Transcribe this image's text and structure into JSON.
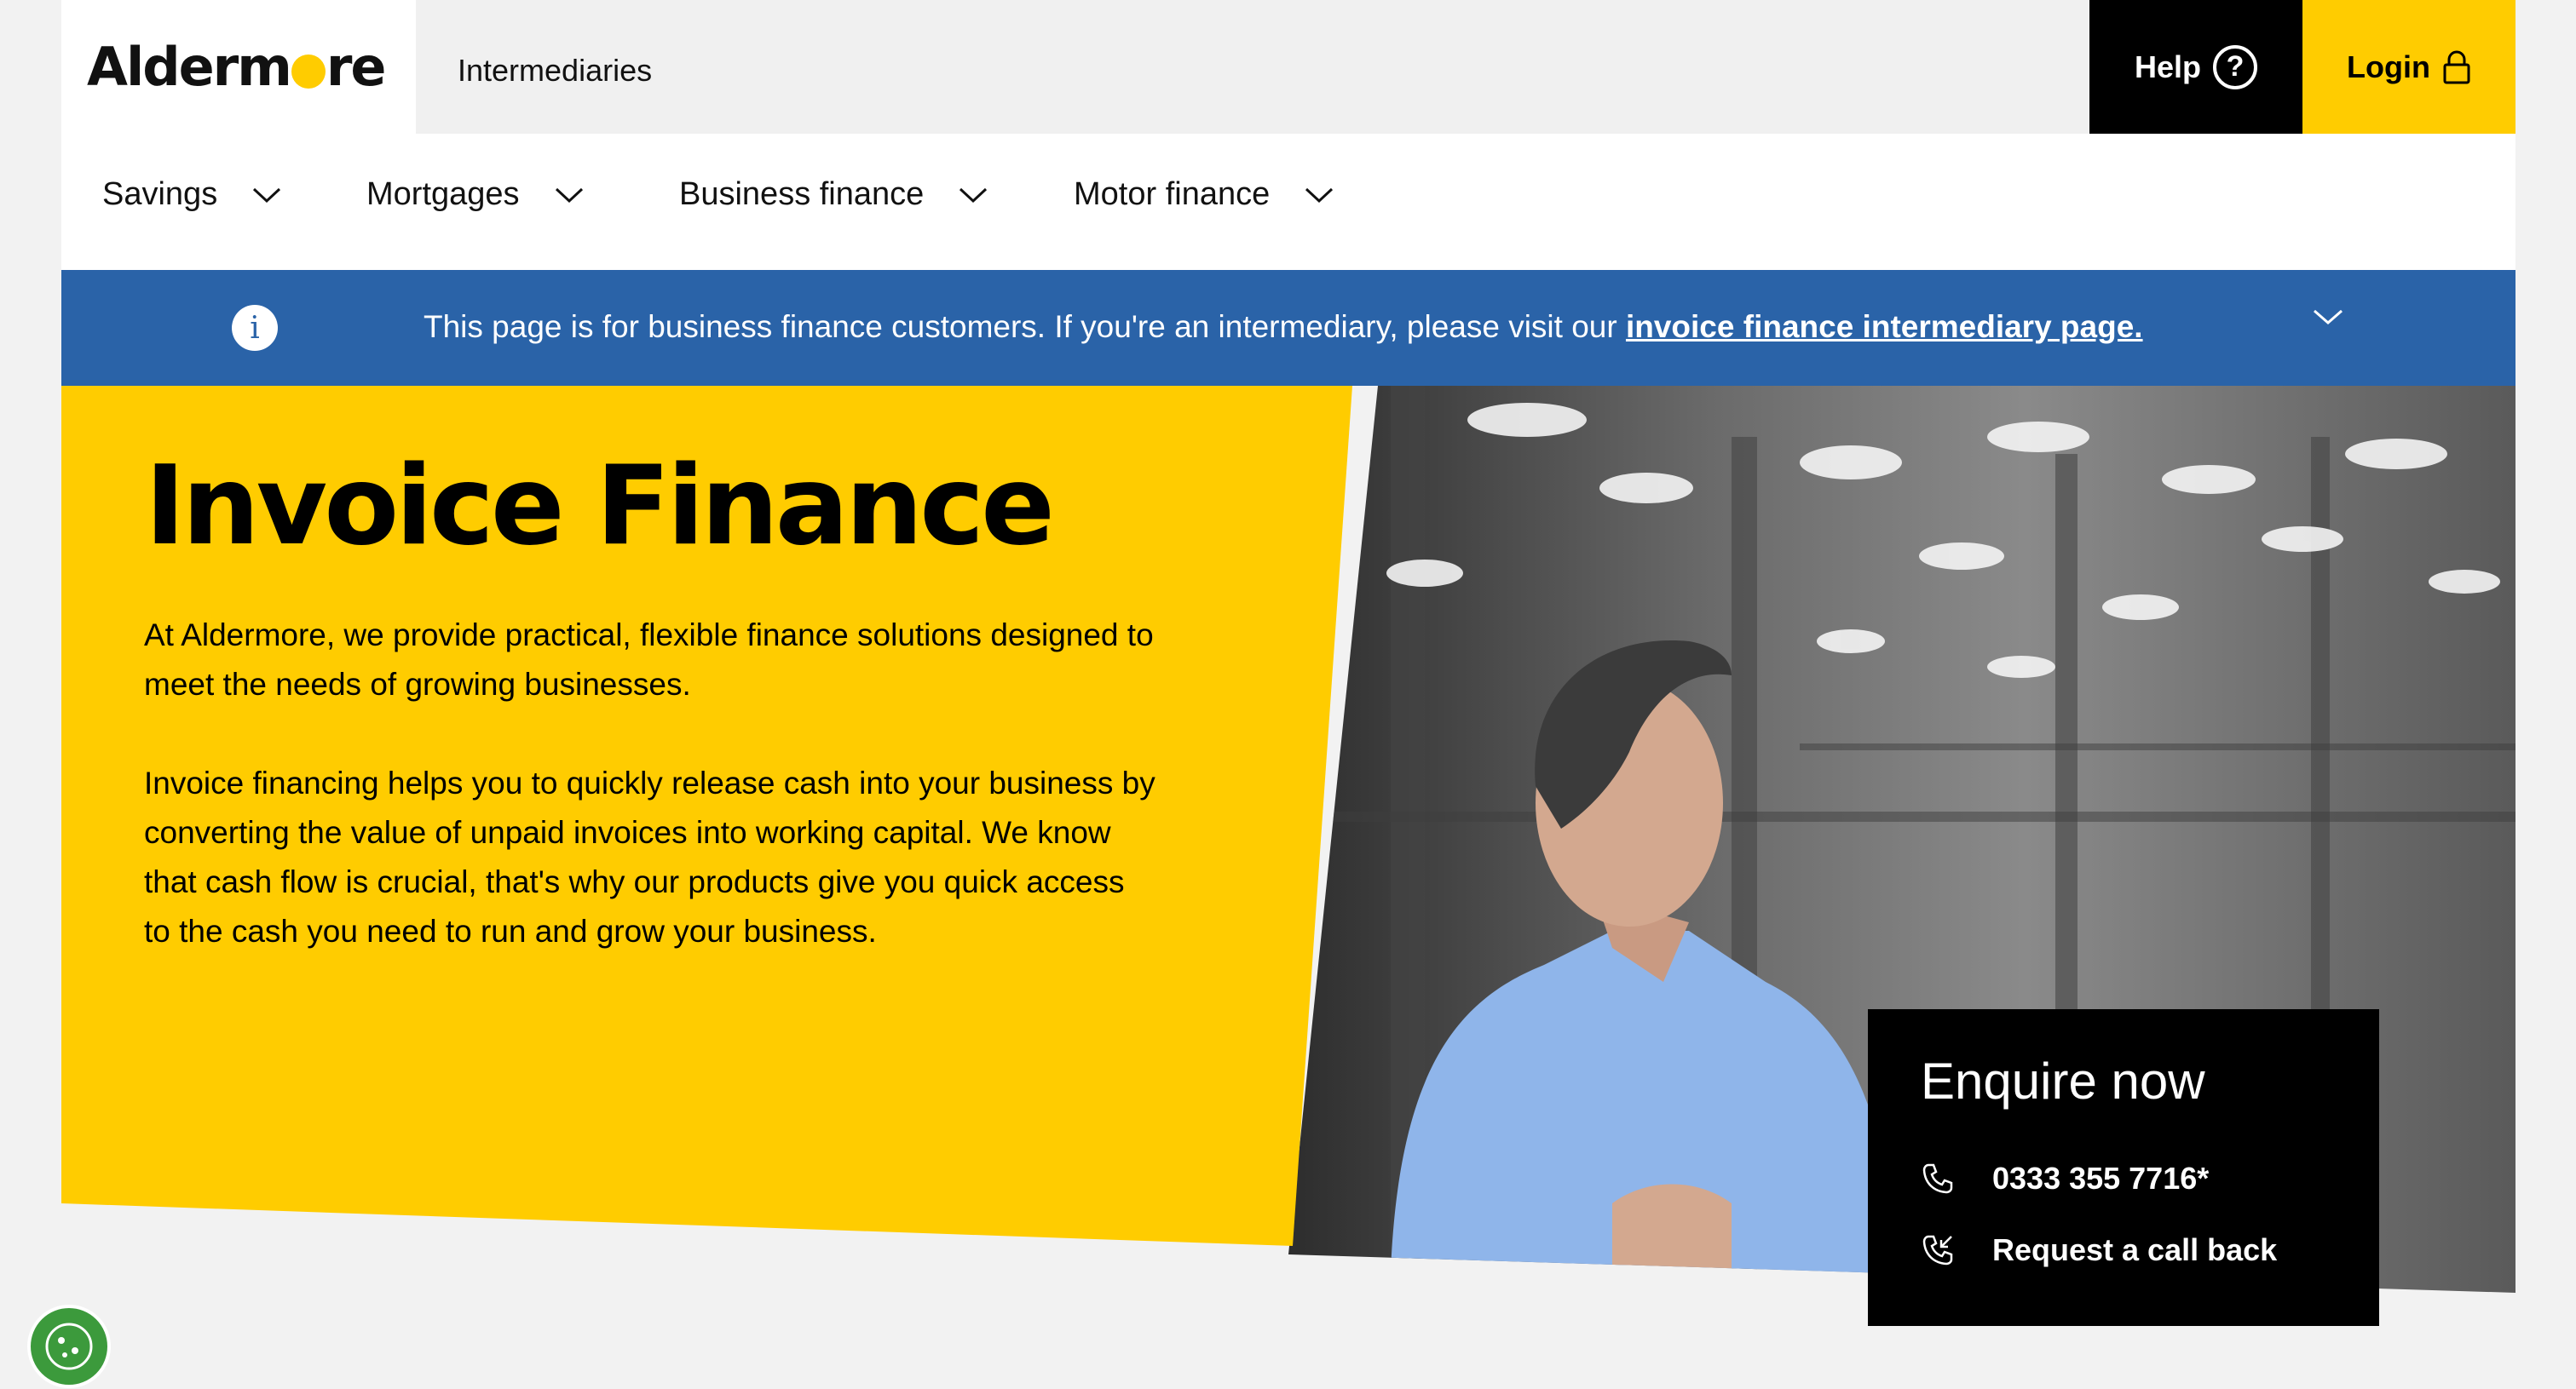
{
  "brand": {
    "logo_text_start": "Alderm",
    "logo_text_end": "re",
    "color_yellow": "#ffcc00",
    "color_blue": "#2a63a8"
  },
  "header": {
    "intermediaries": "Intermediaries",
    "help_label": "Help",
    "help_icon_glyph": "?",
    "login_label": "Login"
  },
  "nav": {
    "items": [
      {
        "label": "Savings"
      },
      {
        "label": "Mortgages"
      },
      {
        "label": "Business finance"
      },
      {
        "label": "Motor finance"
      }
    ]
  },
  "notice": {
    "info_glyph": "i",
    "text": "This page is for business finance customers. If you're an intermediary, please visit our ",
    "link": "invoice finance intermediary page."
  },
  "hero": {
    "title": "Invoice Finance",
    "p1_line1": "At Aldermore, we provide practical, flexible finance solutions designed to",
    "p1_line2": "meet the needs of growing businesses.",
    "p2_line1": "Invoice financing helps you to quickly release cash into your business by",
    "p2_line2": "converting the value of unpaid invoices into working capital. We know",
    "p2_line3": "that cash flow is crucial, that's why our products give you quick access",
    "p2_line4": "to the cash you need to run and grow your business."
  },
  "enquire": {
    "title": "Enquire now",
    "phone": "0333 355 7716*",
    "callback": "Request a call back"
  }
}
